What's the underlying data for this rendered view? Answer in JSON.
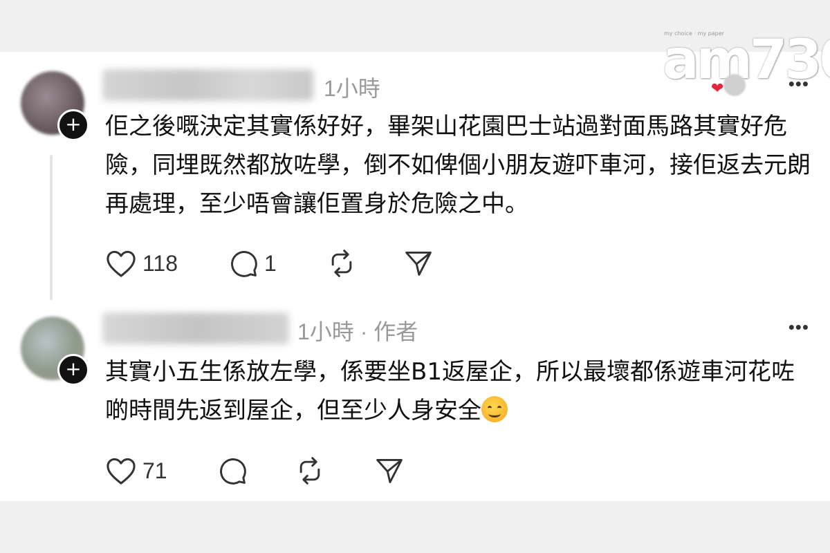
{
  "watermark": {
    "tagline": "my choice · my paper",
    "logo": "am730"
  },
  "comments": [
    {
      "time": "1小時",
      "text": "佢之後嘅決定其實係好好，畢架山花園巴士站過對面馬路其實好危險，同埋既然都放咗學，倒不如俾個小朋友遊吓車河，接佢返去元朗再處理，至少唔會讓佢置身於危險之中。",
      "likes": "118",
      "replies": "1"
    },
    {
      "time": "1小時 · 作者",
      "text": "其實小五生係放左學，係要坐B1返屋企，所以最壞都係遊車河花咗啲時間先返到屋企，但至少人身安全",
      "likes": "71",
      "replies": ""
    }
  ],
  "icons": {
    "like": "heart-icon",
    "reply": "comment-icon",
    "repost": "repost-icon",
    "share": "send-icon",
    "more": "more-icon",
    "follow": "plus-icon",
    "emoji": "smiling-face-emoji"
  },
  "colors": {
    "background": "#f0f0f0",
    "card": "#ffffff",
    "muted": "#999999",
    "heart": "#e8243c"
  }
}
